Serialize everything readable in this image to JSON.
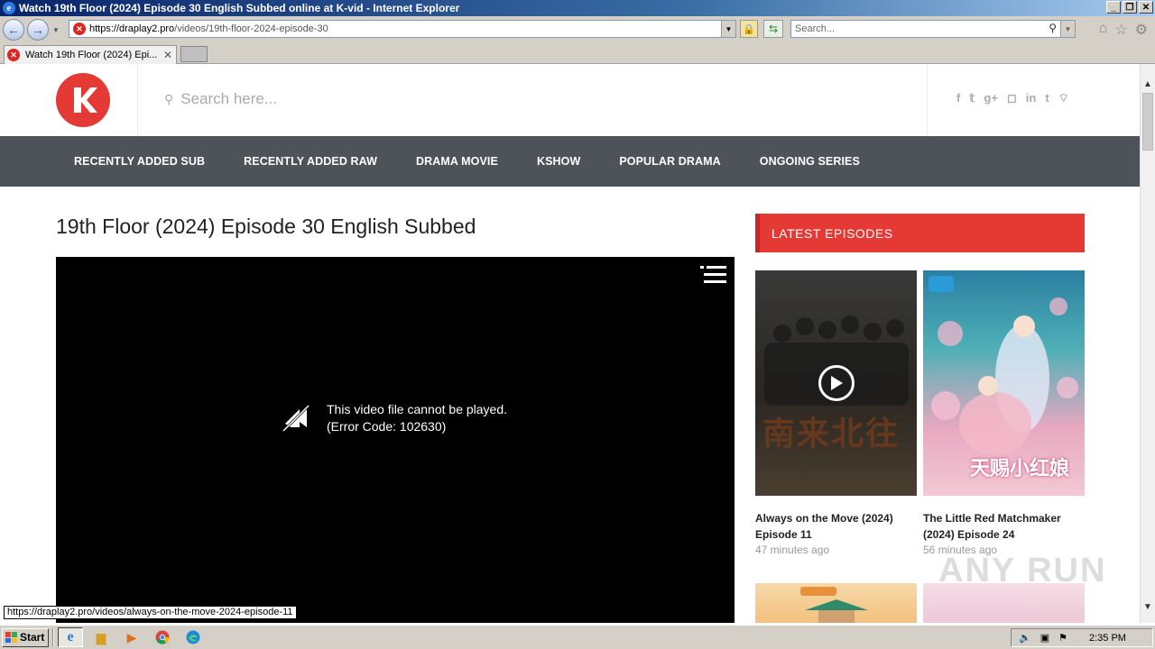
{
  "window": {
    "title": "Watch 19th Floor (2024) Episode 30 English Subbed online at K-vid - Internet Explorer"
  },
  "browser": {
    "url_domain": "https://draplay2.pro",
    "url_path": "/videos/19th-floor-2024-episode-30",
    "search_placeholder": "Search...",
    "tab_title": "Watch 19th Floor (2024) Epi...",
    "status_url": "https://draplay2.pro/videos/always-on-the-move-2024-episode-11"
  },
  "site": {
    "search_placeholder": "Search here...",
    "social": [
      "f",
      "t",
      "g+",
      "ig",
      "in",
      "t",
      "rss"
    ],
    "nav": [
      "RECENTLY ADDED SUB",
      "RECENTLY ADDED RAW",
      "DRAMA MOVIE",
      "KSHOW",
      "POPULAR DRAMA",
      "ONGOING SERIES"
    ]
  },
  "page": {
    "title": "19th Floor (2024) Episode 30 English Subbed",
    "player_error_line1": "This video file cannot be played.",
    "player_error_line2": "(Error Code: 102630)"
  },
  "sidebar": {
    "heading": "LATEST EPISODES",
    "cards": [
      {
        "title": "Always on the Move (2024) Episode 11",
        "time": "47 minutes ago",
        "poster_text": "南来北往"
      },
      {
        "title": "The Little Red Matchmaker (2024) Episode 24",
        "time": "56 minutes ago",
        "poster_text": "天赐小红娘"
      }
    ]
  },
  "watermark": "ANY RUN",
  "taskbar": {
    "start": "Start",
    "clock": "2:35 PM"
  },
  "colors": {
    "accent": "#e53935",
    "nav_bg": "#4e5359"
  }
}
